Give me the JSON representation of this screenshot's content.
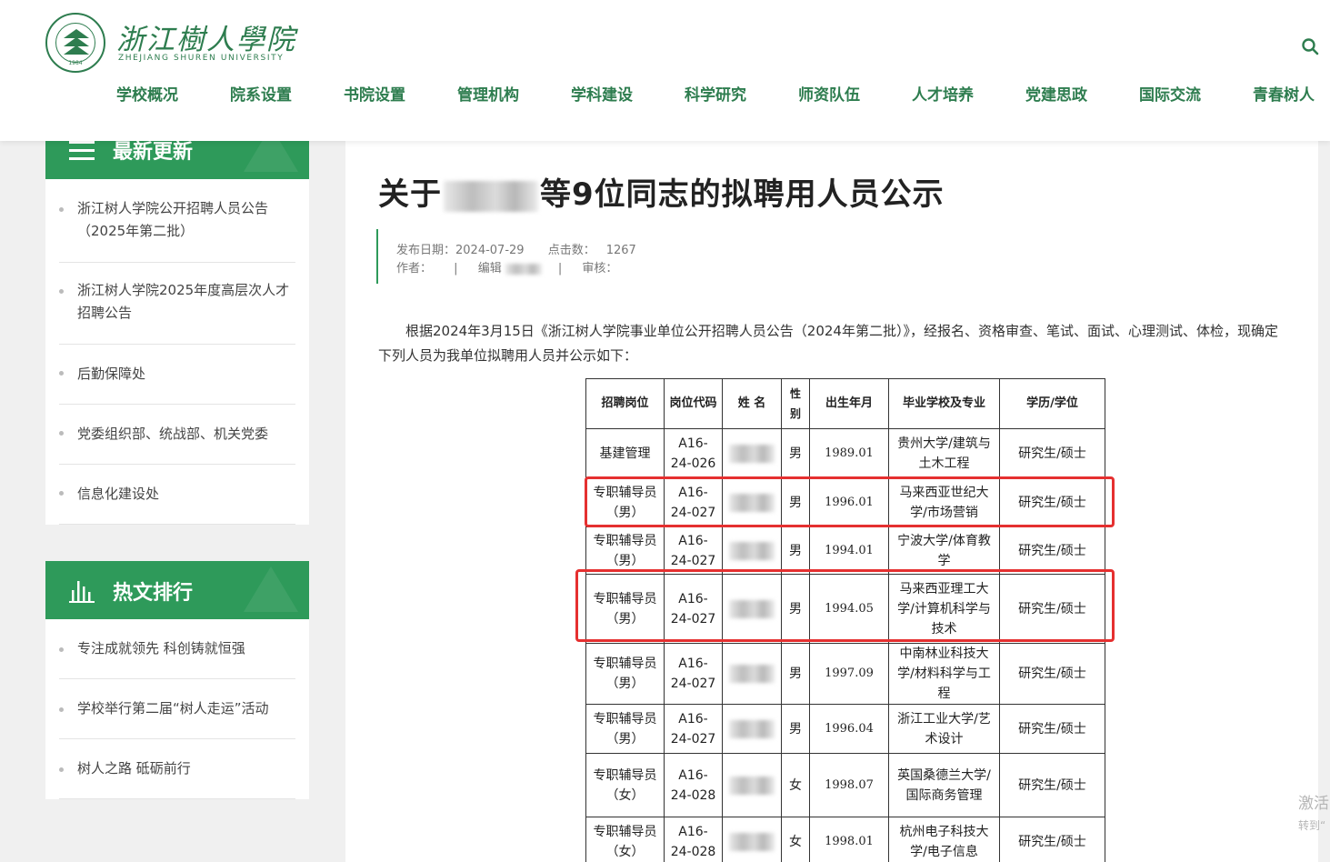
{
  "header": {
    "logo_cn": "浙江樹人學院",
    "logo_en": "ZHEJIANG SHUREN UNIVERSITY",
    "logo_year": "1984",
    "nav": [
      "学校概况",
      "院系设置",
      "书院设置",
      "管理机构",
      "学科建设",
      "科学研究",
      "师资队伍",
      "人才培养",
      "党建思政",
      "国际交流",
      "青春树人"
    ]
  },
  "sidebar": {
    "latest_title": "最新更新",
    "latest": [
      "浙江树人学院公开招聘人员公告（2025年第二批）",
      "浙江树人学院2025年度高层次人才招聘公告",
      "后勤保障处",
      "党委组织部、统战部、机关党委",
      "信息化建设处"
    ],
    "hot_title": "热文排行",
    "hot": [
      "专注成就领先 科创铸就恒强",
      "学校举行第二届“树人走运”活动",
      "树人之路 砥砺前行"
    ]
  },
  "article": {
    "title_prefix": "关于",
    "title_suffix": "等9位同志的拟聘用人员公示",
    "meta": {
      "date_label": "发布日期：",
      "date": "2024-07-29",
      "clicks_label": "点击数：",
      "clicks": "1267",
      "author_label": "作者：",
      "sep": "|",
      "editor_label": "编辑",
      "reviewer_label": "审核："
    },
    "paragraph": "根据2024年3月15日《浙江树人学院事业单位公开招聘人员公告（2024年第二批）》，经报名、资格审查、笔试、面试、心理测试、体检，现确定下列人员为我单位拟聘用人员并公示如下："
  },
  "table": {
    "headers": [
      "招聘岗位",
      "岗位代码",
      "姓 名",
      "性别",
      "出生年月",
      "毕业学校及专业",
      "学历/学位"
    ],
    "rows": [
      {
        "post": "基建管理",
        "code": "A16-24-026",
        "gender": "男",
        "dob": "1989.01",
        "school": "贵州大学/建筑与土木工程",
        "degree": "研究生/硕士"
      },
      {
        "post": "专职辅导员（男）",
        "code": "A16-24-027",
        "gender": "男",
        "dob": "1996.01",
        "school": "马来西亚世纪大学/市场营销",
        "degree": "研究生/硕士"
      },
      {
        "post": "专职辅导员（男）",
        "code": "A16-24-027",
        "gender": "男",
        "dob": "1994.01",
        "school": "宁波大学/体育教学",
        "degree": "研究生/硕士"
      },
      {
        "post": "专职辅导员（男）",
        "code": "A16-24-027",
        "gender": "男",
        "dob": "1994.05",
        "school": "马来西亚理工大学/计算机科学与技术",
        "degree": "研究生/硕士"
      },
      {
        "post": "专职辅导员（男）",
        "code": "A16-24-027",
        "gender": "男",
        "dob": "1997.09",
        "school": "中南林业科技大学/材料科学与工程",
        "degree": "研究生/硕士"
      },
      {
        "post": "专职辅导员（男）",
        "code": "A16-24-027",
        "gender": "男",
        "dob": "1996.04",
        "school": "浙江工业大学/艺术设计",
        "degree": "研究生/硕士"
      },
      {
        "post": "专职辅导员（女）",
        "code": "A16-24-028",
        "gender": "女",
        "dob": "1998.07",
        "school": "英国桑德兰大学/国际商务管理",
        "degree": "研究生/硕士"
      },
      {
        "post": "专职辅导员（女）",
        "code": "A16-24-028",
        "gender": "女",
        "dob": "1998.01",
        "school": "杭州电子科技大学/电子信息",
        "degree": "研究生/硕士"
      }
    ]
  },
  "watermark": {
    "line1": "激活",
    "line2": "转到“"
  },
  "colors": {
    "brand_green": "#2e7d4f",
    "sidebar_green": "#2e9a5a",
    "highlight_red": "#e53030"
  }
}
